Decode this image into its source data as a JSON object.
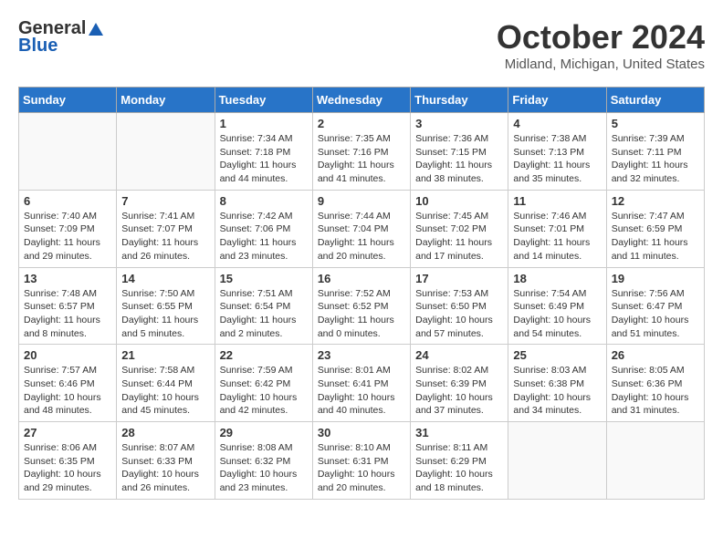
{
  "header": {
    "logo_general": "General",
    "logo_blue": "Blue",
    "title": "October 2024",
    "location": "Midland, Michigan, United States"
  },
  "weekdays": [
    "Sunday",
    "Monday",
    "Tuesday",
    "Wednesday",
    "Thursday",
    "Friday",
    "Saturday"
  ],
  "weeks": [
    [
      {
        "day": "",
        "sunrise": "",
        "sunset": "",
        "daylight": ""
      },
      {
        "day": "",
        "sunrise": "",
        "sunset": "",
        "daylight": ""
      },
      {
        "day": "1",
        "sunrise": "Sunrise: 7:34 AM",
        "sunset": "Sunset: 7:18 PM",
        "daylight": "Daylight: 11 hours and 44 minutes."
      },
      {
        "day": "2",
        "sunrise": "Sunrise: 7:35 AM",
        "sunset": "Sunset: 7:16 PM",
        "daylight": "Daylight: 11 hours and 41 minutes."
      },
      {
        "day": "3",
        "sunrise": "Sunrise: 7:36 AM",
        "sunset": "Sunset: 7:15 PM",
        "daylight": "Daylight: 11 hours and 38 minutes."
      },
      {
        "day": "4",
        "sunrise": "Sunrise: 7:38 AM",
        "sunset": "Sunset: 7:13 PM",
        "daylight": "Daylight: 11 hours and 35 minutes."
      },
      {
        "day": "5",
        "sunrise": "Sunrise: 7:39 AM",
        "sunset": "Sunset: 7:11 PM",
        "daylight": "Daylight: 11 hours and 32 minutes."
      }
    ],
    [
      {
        "day": "6",
        "sunrise": "Sunrise: 7:40 AM",
        "sunset": "Sunset: 7:09 PM",
        "daylight": "Daylight: 11 hours and 29 minutes."
      },
      {
        "day": "7",
        "sunrise": "Sunrise: 7:41 AM",
        "sunset": "Sunset: 7:07 PM",
        "daylight": "Daylight: 11 hours and 26 minutes."
      },
      {
        "day": "8",
        "sunrise": "Sunrise: 7:42 AM",
        "sunset": "Sunset: 7:06 PM",
        "daylight": "Daylight: 11 hours and 23 minutes."
      },
      {
        "day": "9",
        "sunrise": "Sunrise: 7:44 AM",
        "sunset": "Sunset: 7:04 PM",
        "daylight": "Daylight: 11 hours and 20 minutes."
      },
      {
        "day": "10",
        "sunrise": "Sunrise: 7:45 AM",
        "sunset": "Sunset: 7:02 PM",
        "daylight": "Daylight: 11 hours and 17 minutes."
      },
      {
        "day": "11",
        "sunrise": "Sunrise: 7:46 AM",
        "sunset": "Sunset: 7:01 PM",
        "daylight": "Daylight: 11 hours and 14 minutes."
      },
      {
        "day": "12",
        "sunrise": "Sunrise: 7:47 AM",
        "sunset": "Sunset: 6:59 PM",
        "daylight": "Daylight: 11 hours and 11 minutes."
      }
    ],
    [
      {
        "day": "13",
        "sunrise": "Sunrise: 7:48 AM",
        "sunset": "Sunset: 6:57 PM",
        "daylight": "Daylight: 11 hours and 8 minutes."
      },
      {
        "day": "14",
        "sunrise": "Sunrise: 7:50 AM",
        "sunset": "Sunset: 6:55 PM",
        "daylight": "Daylight: 11 hours and 5 minutes."
      },
      {
        "day": "15",
        "sunrise": "Sunrise: 7:51 AM",
        "sunset": "Sunset: 6:54 PM",
        "daylight": "Daylight: 11 hours and 2 minutes."
      },
      {
        "day": "16",
        "sunrise": "Sunrise: 7:52 AM",
        "sunset": "Sunset: 6:52 PM",
        "daylight": "Daylight: 11 hours and 0 minutes."
      },
      {
        "day": "17",
        "sunrise": "Sunrise: 7:53 AM",
        "sunset": "Sunset: 6:50 PM",
        "daylight": "Daylight: 10 hours and 57 minutes."
      },
      {
        "day": "18",
        "sunrise": "Sunrise: 7:54 AM",
        "sunset": "Sunset: 6:49 PM",
        "daylight": "Daylight: 10 hours and 54 minutes."
      },
      {
        "day": "19",
        "sunrise": "Sunrise: 7:56 AM",
        "sunset": "Sunset: 6:47 PM",
        "daylight": "Daylight: 10 hours and 51 minutes."
      }
    ],
    [
      {
        "day": "20",
        "sunrise": "Sunrise: 7:57 AM",
        "sunset": "Sunset: 6:46 PM",
        "daylight": "Daylight: 10 hours and 48 minutes."
      },
      {
        "day": "21",
        "sunrise": "Sunrise: 7:58 AM",
        "sunset": "Sunset: 6:44 PM",
        "daylight": "Daylight: 10 hours and 45 minutes."
      },
      {
        "day": "22",
        "sunrise": "Sunrise: 7:59 AM",
        "sunset": "Sunset: 6:42 PM",
        "daylight": "Daylight: 10 hours and 42 minutes."
      },
      {
        "day": "23",
        "sunrise": "Sunrise: 8:01 AM",
        "sunset": "Sunset: 6:41 PM",
        "daylight": "Daylight: 10 hours and 40 minutes."
      },
      {
        "day": "24",
        "sunrise": "Sunrise: 8:02 AM",
        "sunset": "Sunset: 6:39 PM",
        "daylight": "Daylight: 10 hours and 37 minutes."
      },
      {
        "day": "25",
        "sunrise": "Sunrise: 8:03 AM",
        "sunset": "Sunset: 6:38 PM",
        "daylight": "Daylight: 10 hours and 34 minutes."
      },
      {
        "day": "26",
        "sunrise": "Sunrise: 8:05 AM",
        "sunset": "Sunset: 6:36 PM",
        "daylight": "Daylight: 10 hours and 31 minutes."
      }
    ],
    [
      {
        "day": "27",
        "sunrise": "Sunrise: 8:06 AM",
        "sunset": "Sunset: 6:35 PM",
        "daylight": "Daylight: 10 hours and 29 minutes."
      },
      {
        "day": "28",
        "sunrise": "Sunrise: 8:07 AM",
        "sunset": "Sunset: 6:33 PM",
        "daylight": "Daylight: 10 hours and 26 minutes."
      },
      {
        "day": "29",
        "sunrise": "Sunrise: 8:08 AM",
        "sunset": "Sunset: 6:32 PM",
        "daylight": "Daylight: 10 hours and 23 minutes."
      },
      {
        "day": "30",
        "sunrise": "Sunrise: 8:10 AM",
        "sunset": "Sunset: 6:31 PM",
        "daylight": "Daylight: 10 hours and 20 minutes."
      },
      {
        "day": "31",
        "sunrise": "Sunrise: 8:11 AM",
        "sunset": "Sunset: 6:29 PM",
        "daylight": "Daylight: 10 hours and 18 minutes."
      },
      {
        "day": "",
        "sunrise": "",
        "sunset": "",
        "daylight": ""
      },
      {
        "day": "",
        "sunrise": "",
        "sunset": "",
        "daylight": ""
      }
    ]
  ]
}
